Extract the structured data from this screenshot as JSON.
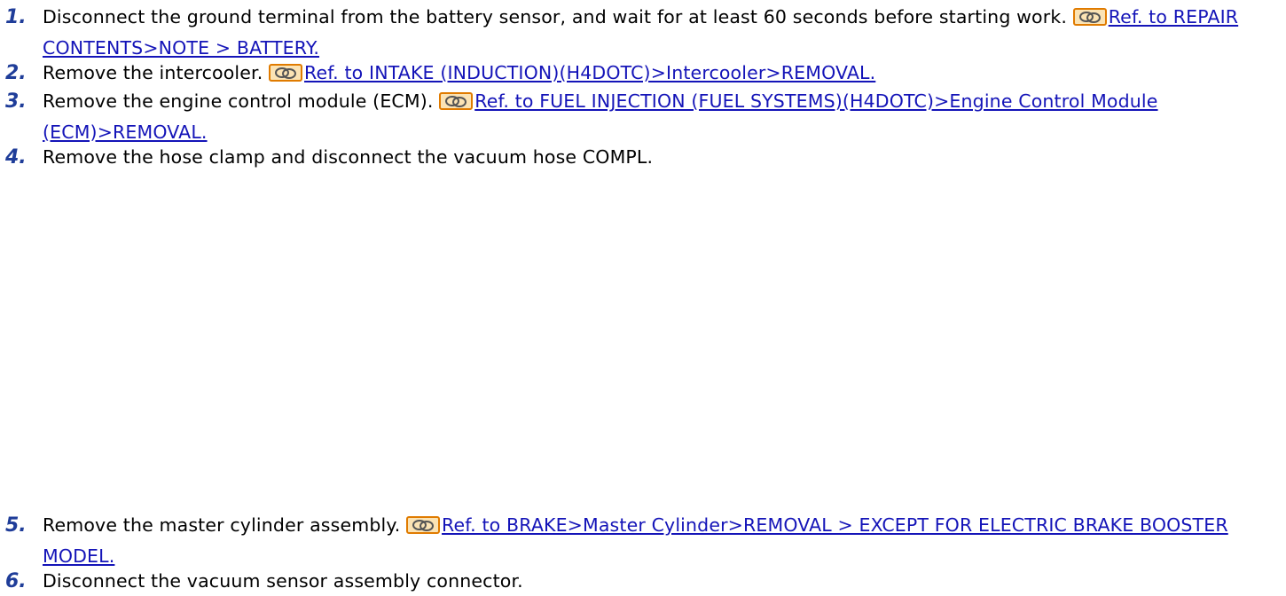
{
  "colors": {
    "step_number": "#1f3d99",
    "link": "#1414b8",
    "icon_border": "#e07b00",
    "icon_fill": "#fbe3b4"
  },
  "icon_name": "link-reference-icon",
  "steps": [
    {
      "number": "1.",
      "text": "Disconnect the ground terminal from the battery sensor, and wait for at least 60 seconds before starting work.",
      "ref": "Ref. to REPAIR CONTENTS>NOTE > BATTERY."
    },
    {
      "number": "2.",
      "text": "Remove the intercooler.",
      "ref": "Ref. to INTAKE (INDUCTION)(H4DOTC)>Intercooler>REMOVAL."
    },
    {
      "number": "3.",
      "text": "Remove the engine control module (ECM).",
      "ref": "Ref. to FUEL INJECTION (FUEL SYSTEMS)(H4DOTC)>Engine Control Module (ECM)>REMOVAL."
    },
    {
      "number": "4.",
      "text": "Remove the hose clamp and disconnect the vacuum hose COMPL."
    },
    {
      "number": "5.",
      "text": "Remove the master cylinder assembly.",
      "ref": "Ref. to BRAKE>Master Cylinder>REMOVAL > EXCEPT FOR ELECTRIC BRAKE BOOSTER MODEL."
    },
    {
      "number": "6.",
      "text": "Disconnect the vacuum sensor assembly connector."
    }
  ]
}
